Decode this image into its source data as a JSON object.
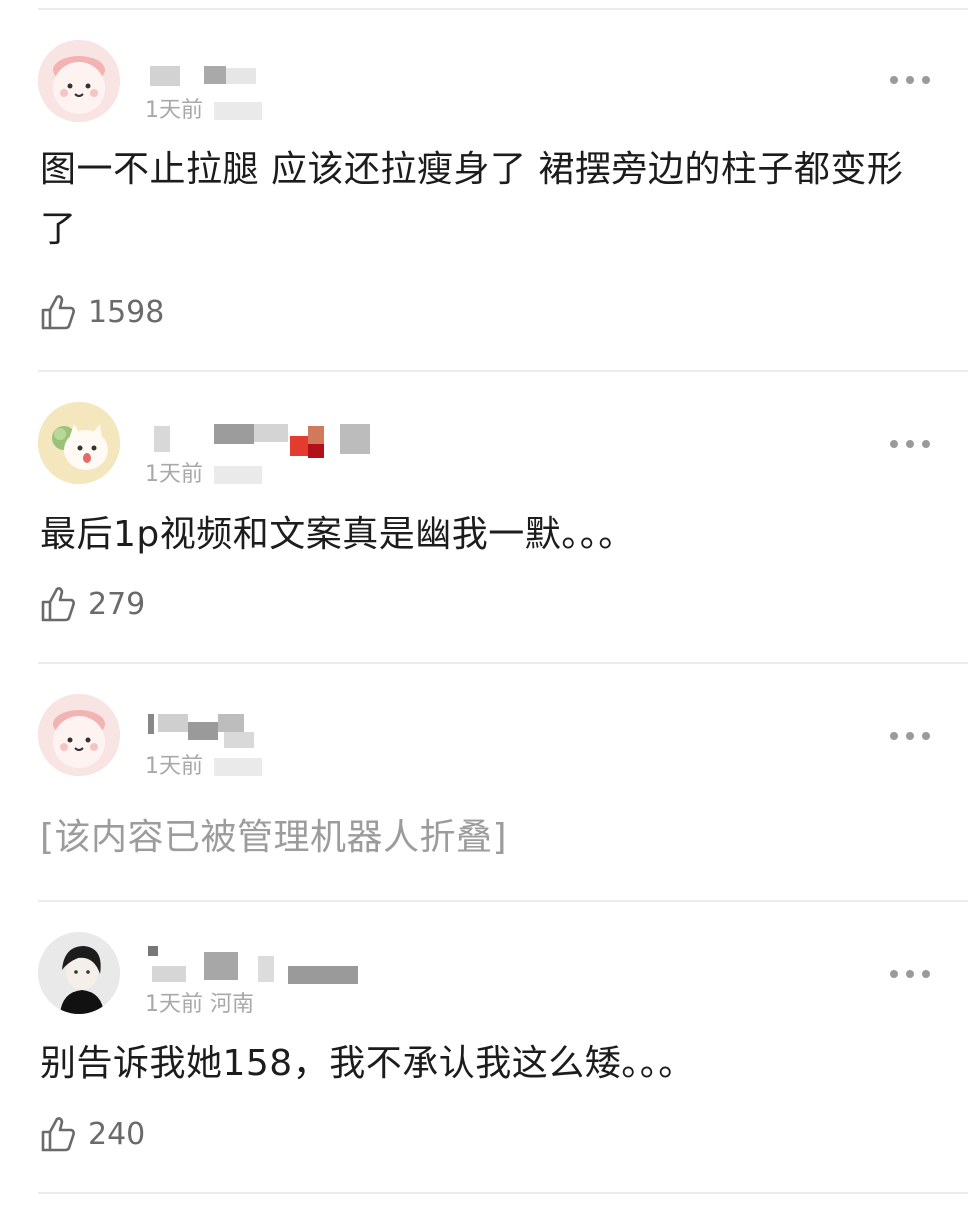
{
  "comments": [
    {
      "time": "1天前",
      "text": "图一不止拉腿 应该还拉瘦身了  裙摆旁边的柱子都变形了",
      "likes": "1598",
      "avatar": "pink-bunny-avatar"
    },
    {
      "time": "1天前",
      "text": "最后1p视频和文案真是幽我一默。。。",
      "likes": "279",
      "avatar": "cat-with-cabbage-avatar"
    },
    {
      "time": "1天前",
      "text": "[该内容已被管理机器人折叠]",
      "avatar": "pink-bunny-avatar"
    },
    {
      "time": "1天前 河南",
      "text": "别告诉我她158，我不承认我这么矮。。。",
      "likes": "240",
      "avatar": "dark-hair-boy-avatar"
    }
  ],
  "colors": {
    "text": "#1c1c1c",
    "meta": "#a8a8a8",
    "folded": "#9c9c9c",
    "divider": "#ececec"
  },
  "icons": {
    "more": "more-horizontal-icon",
    "like": "thumbs-up-icon"
  }
}
